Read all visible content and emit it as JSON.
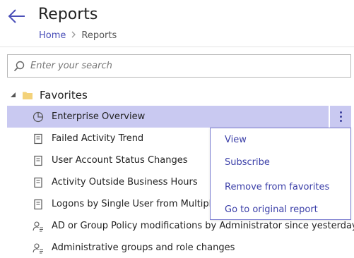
{
  "header": {
    "title": "Reports",
    "back_icon": "arrow-left-icon"
  },
  "breadcrumb": {
    "items": [
      "Home",
      "Reports"
    ],
    "separator_icon": "chevron-right-icon"
  },
  "search": {
    "placeholder": "Enter your search",
    "value": "",
    "icon": "search-icon"
  },
  "tree": {
    "group": {
      "label": "Favorites",
      "expanded": true,
      "icon": "folder-icon"
    },
    "items": [
      {
        "label": "Enterprise Overview",
        "icon": "pie-chart-icon",
        "selected": true
      },
      {
        "label": "Failed Activity Trend",
        "icon": "document-icon"
      },
      {
        "label": "User Account Status Changes",
        "icon": "document-icon"
      },
      {
        "label": "Activity Outside Business Hours",
        "icon": "document-icon"
      },
      {
        "label": "Logons by Single User from Multiple Endpoints",
        "icon": "document-icon"
      },
      {
        "label": "AD or Group Policy modifications by Administrator since yesterday",
        "icon": "user-search-icon"
      },
      {
        "label": "Administrative groups and role changes",
        "icon": "user-search-icon"
      }
    ]
  },
  "context_menu": {
    "items": [
      "View",
      "Subscribe",
      "Remove from favorites",
      "Go to original report"
    ]
  },
  "colors": {
    "accent": "#4a4fb8",
    "selection": "#c9c9f1",
    "menu_border": "#7d7fd1",
    "menu_text": "#3b3fa8"
  }
}
